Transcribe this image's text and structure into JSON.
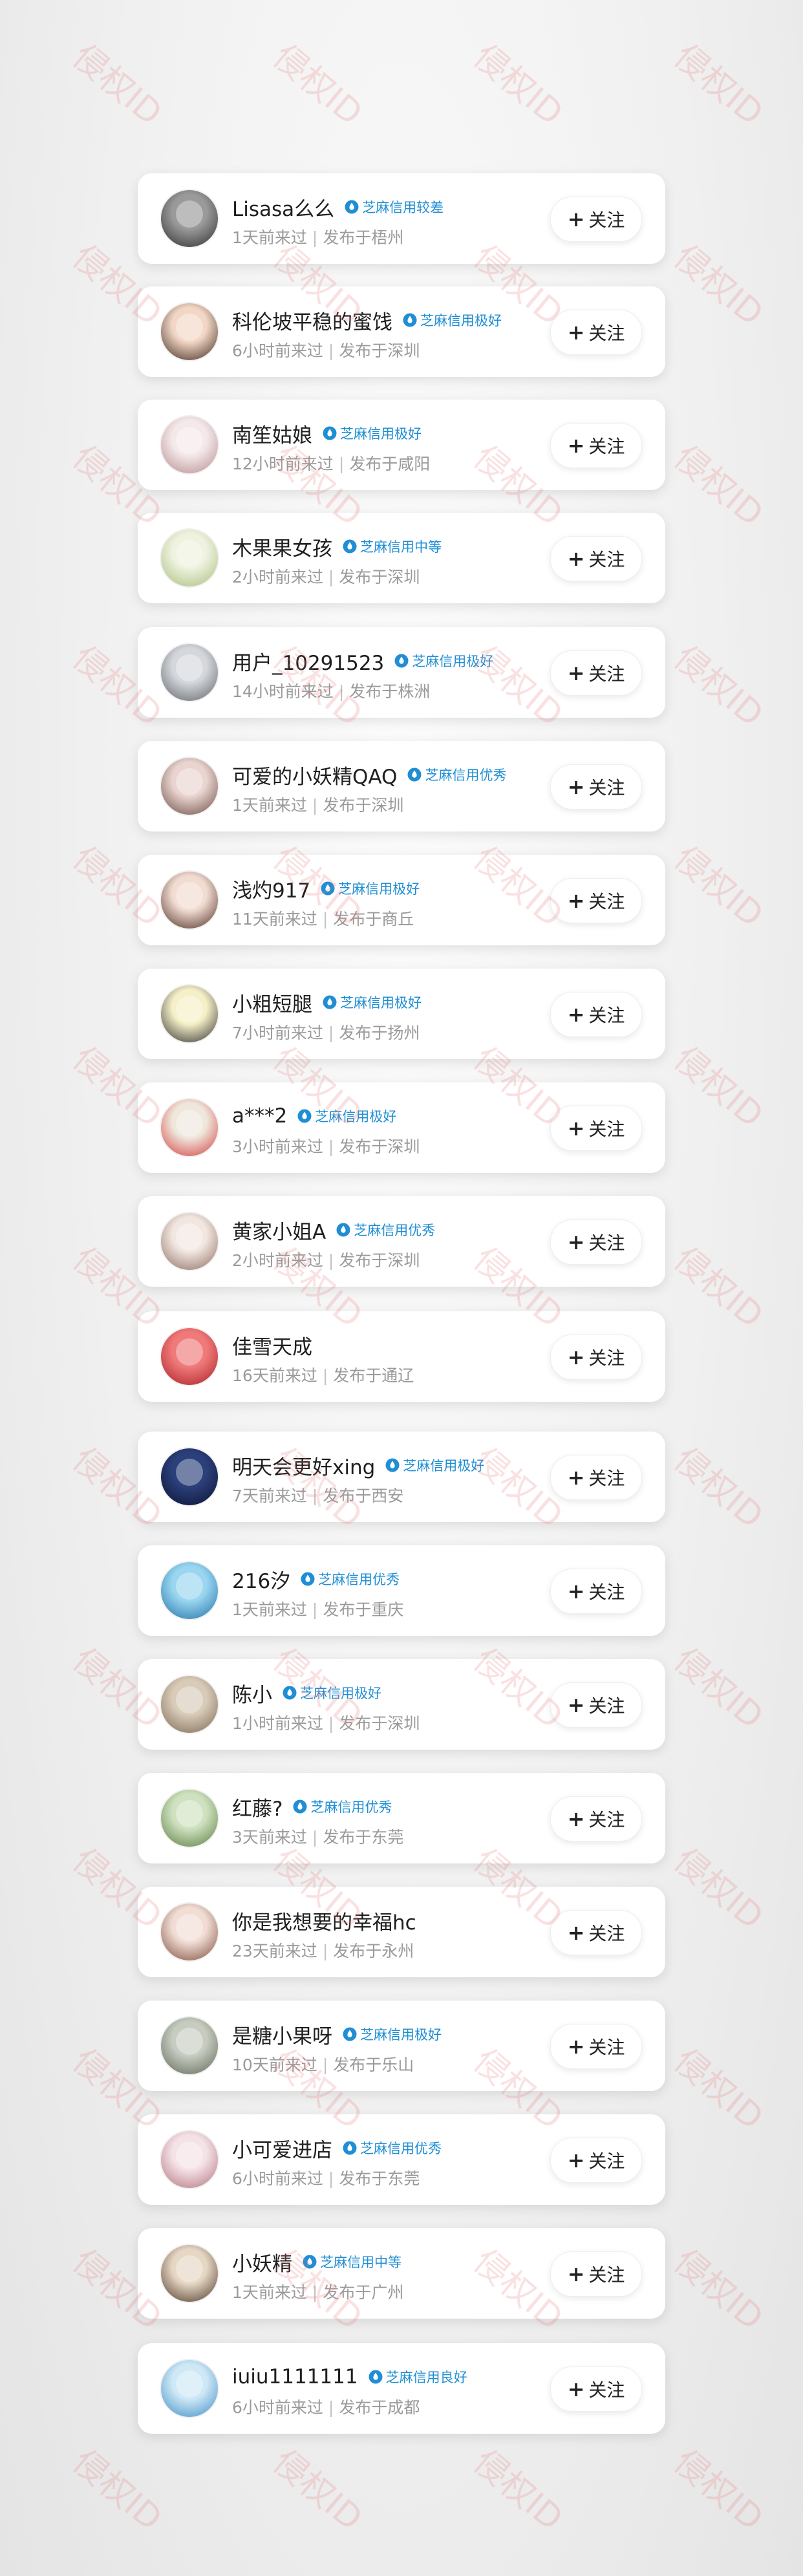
{
  "watermark_text": "侵权ID",
  "badge_icon": "sesame-credit-drop-icon",
  "follow_label": "关注",
  "follow_icon": "plus-icon",
  "colors": {
    "badge_text": "#1f8ed4",
    "name_text": "#1f1f1f",
    "meta_text": "#9a9a9a",
    "watermark": "#e67878"
  },
  "users": [
    {
      "name": "Lisasa么么",
      "badge": "芝麻信用较差",
      "time": "1天前来过",
      "location": "发布于梧州",
      "avatar": "avatar-photo-icon",
      "avatar_colors": [
        "#9a9a9a",
        "#2c2c2c"
      ]
    },
    {
      "name": "科伦坡平稳的蜜饯",
      "badge": "芝麻信用极好",
      "time": "6小时前来过",
      "location": "发布于深圳",
      "avatar": "avatar-photo-icon",
      "avatar_colors": [
        "#f3d7c6",
        "#3a2418"
      ]
    },
    {
      "name": "南笙姑娘",
      "badge": "芝麻信用极好",
      "time": "12小时前来过",
      "location": "发布于咸阳",
      "avatar": "avatar-photo-icon",
      "avatar_colors": [
        "#f4e9ea",
        "#b58a8c"
      ]
    },
    {
      "name": "木果果女孩",
      "badge": "芝麻信用中等",
      "time": "2小时前来过",
      "location": "发布于深圳",
      "avatar": "avatar-photo-icon",
      "avatar_colors": [
        "#eef2df",
        "#a7bd7a"
      ]
    },
    {
      "name": "用户_10291523",
      "badge": "芝麻信用极好",
      "time": "14小时前来过",
      "location": "发布于株洲",
      "avatar": "avatar-photo-icon",
      "avatar_colors": [
        "#d4d8dc",
        "#5d6166"
      ]
    },
    {
      "name": "可爱的小妖精QAQ",
      "badge": "芝麻信用优秀",
      "time": "1天前来过",
      "location": "发布于深圳",
      "avatar": "avatar-photo-icon",
      "avatar_colors": [
        "#e9d4cf",
        "#6a4842"
      ]
    },
    {
      "name": "浅灼917",
      "badge": "芝麻信用极好",
      "time": "11天前来过",
      "location": "发布于商丘",
      "avatar": "avatar-photo-icon",
      "avatar_colors": [
        "#f2dcd2",
        "#4a2a20"
      ]
    },
    {
      "name": "小粗短腿",
      "badge": "芝麻信用极好",
      "time": "7小时前来过",
      "location": "发布于扬州",
      "avatar": "avatar-photo-icon",
      "avatar_colors": [
        "#f6f0c8",
        "#2a2a2a"
      ]
    },
    {
      "name": "a***2",
      "badge": "芝麻信用极好",
      "time": "3小时前来过",
      "location": "发布于深圳",
      "avatar": "avatar-photo-icon",
      "avatar_colors": [
        "#efe7dc",
        "#d13a3a"
      ]
    },
    {
      "name": "黄家小姐A",
      "badge": "芝麻信用优秀",
      "time": "2小时前来过",
      "location": "发布于深圳",
      "avatar": "avatar-photo-icon",
      "avatar_colors": [
        "#f1e6e0",
        "#8b6a5c"
      ]
    },
    {
      "name": "佳雪天成",
      "badge": "",
      "time": "16天前来过",
      "location": "发布于通辽",
      "avatar": "avatar-photo-icon",
      "avatar_colors": [
        "#f07a7a",
        "#a81e24"
      ]
    },
    {
      "name": "明天会更好xing",
      "badge": "芝麻信用极好",
      "time": "7天前来过",
      "location": "发布于西安",
      "avatar": "avatar-photo-icon",
      "avatar_colors": [
        "#2b3f7a",
        "#0b1230"
      ]
    },
    {
      "name": "216汐",
      "badge": "芝麻信用优秀",
      "time": "1天前来过",
      "location": "发布于重庆",
      "avatar": "avatar-photo-icon",
      "avatar_colors": [
        "#9ad6f0",
        "#1d6fa6"
      ]
    },
    {
      "name": "陈小",
      "badge": "芝麻信用极好",
      "time": "1小时前来过",
      "location": "发布于深圳",
      "avatar": "avatar-photo-icon",
      "avatar_colors": [
        "#d8cbb8",
        "#7a6650"
      ]
    },
    {
      "name": "红藤?",
      "badge": "芝麻信用优秀",
      "time": "3天前来过",
      "location": "发布于东莞",
      "avatar": "avatar-photo-icon",
      "avatar_colors": [
        "#cfe2c0",
        "#587a3e"
      ]
    },
    {
      "name": "你是我想要的幸福hc",
      "badge": "",
      "time": "23天前来过",
      "location": "发布于永州",
      "avatar": "avatar-photo-icon",
      "avatar_colors": [
        "#f1ddd4",
        "#7c4a3a"
      ]
    },
    {
      "name": "是糖小果呀",
      "badge": "芝麻信用极好",
      "time": "10天前来过",
      "location": "发布于乐山",
      "avatar": "avatar-photo-icon",
      "avatar_colors": [
        "#c6ccc0",
        "#5c6656"
      ]
    },
    {
      "name": "小可爱进店",
      "badge": "芝麻信用优秀",
      "time": "6小时前来过",
      "location": "发布于东莞",
      "avatar": "avatar-photo-icon",
      "avatar_colors": [
        "#f4e2e6",
        "#b0707c"
      ]
    },
    {
      "name": "小妖精",
      "badge": "芝麻信用中等",
      "time": "1天前来过",
      "location": "发布于广州",
      "avatar": "avatar-photo-icon",
      "avatar_colors": [
        "#e6d6c4",
        "#4a3424"
      ]
    },
    {
      "name": "iuiu1111111",
      "badge": "芝麻信用良好",
      "time": "6小时前来过",
      "location": "发布于成都",
      "avatar": "avatar-photo-icon",
      "avatar_colors": [
        "#cfe8f6",
        "#3c8cc6"
      ]
    }
  ]
}
